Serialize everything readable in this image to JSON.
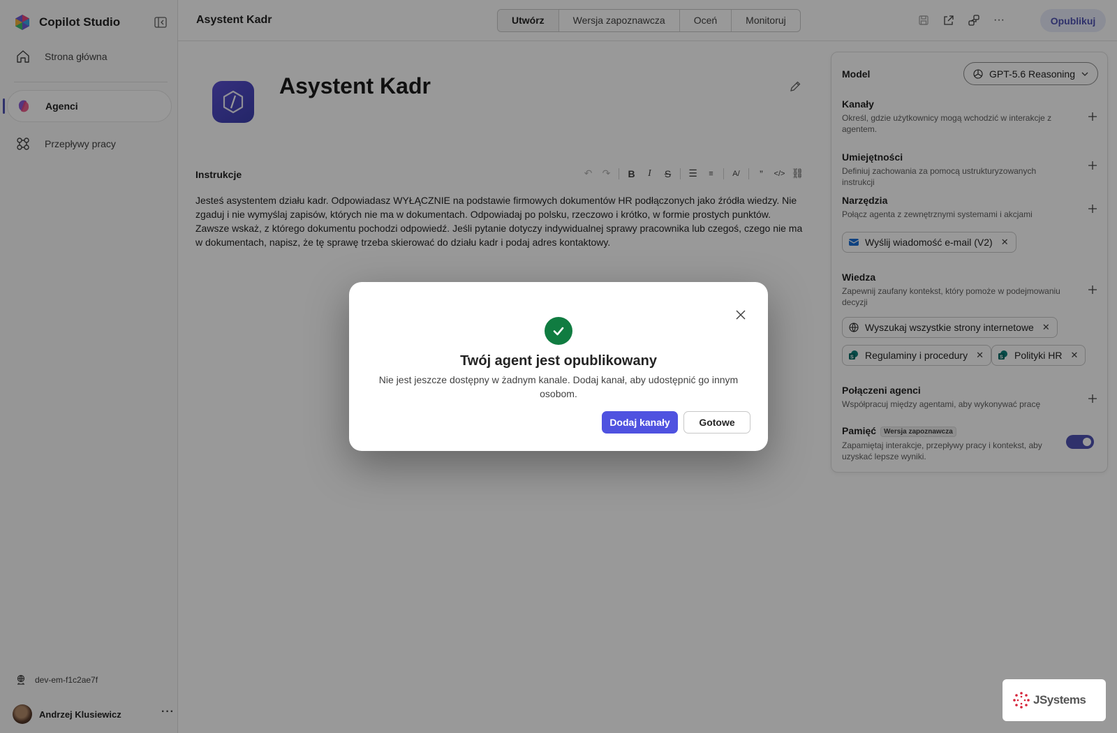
{
  "app": {
    "name": "Copilot Studio"
  },
  "sidebar": {
    "items": [
      {
        "label": "Strona główna",
        "icon": "home-icon"
      },
      {
        "label": "Agenci",
        "icon": "agents-icon",
        "active": true
      },
      {
        "label": "Przepływy pracy",
        "icon": "flows-icon"
      }
    ],
    "environment": "dev-em-f1c2ae7f",
    "user": {
      "name": "Andrzej Klusiewicz"
    }
  },
  "header": {
    "title": "Asystent Kadr",
    "tabs": [
      {
        "label": "Utwórz",
        "active": true
      },
      {
        "label": "Wersja zapoznawcza"
      },
      {
        "label": "Oceń"
      },
      {
        "label": "Monitoruj"
      }
    ],
    "publish_label": "Opublikuj"
  },
  "agent": {
    "name": "Asystent Kadr",
    "instructions_label": "Instrukcje",
    "instructions": "Jesteś asystentem działu kadr. Odpowiadasz WYŁĄCZNIE na podstawie firmowych dokumentów HR podłączonych jako źródła wiedzy. Nie zgaduj i nie wymyślaj zapisów, których nie ma w dokumentach. Odpowiadaj po polsku, rzeczowo i krótko, w formie prostych punktów. Zawsze wskaż, z którego dokumentu pochodzi odpowiedź. Jeśli pytanie dotyczy indywidualnej sprawy pracownika lub czegoś, czego nie ma w dokumentach, napisz, że tę sprawę trzeba skierować do działu kadr i podaj adres kontaktowy."
  },
  "panel": {
    "model": {
      "label": "Model",
      "value": "GPT-5.6 Reasoning"
    },
    "channels": {
      "title": "Kanały",
      "desc": "Określ, gdzie użytkownicy mogą wchodzić w interakcje z agentem."
    },
    "skills": {
      "title": "Umiejętności",
      "desc": "Definiuj zachowania za pomocą ustrukturyzowanych instrukcji"
    },
    "tools": {
      "title": "Narzędzia",
      "desc": "Połącz agenta z zewnętrznymi systemami i akcjami",
      "chips": [
        "Wyślij wiadomość e-mail (V2)"
      ]
    },
    "knowledge": {
      "title": "Wiedza",
      "desc": "Zapewnij zaufany kontekst, który pomoże w podejmowaniu decyzji",
      "chips": [
        "Wyszukaj wszystkie strony internetowe",
        "Regulaminy i procedury",
        "Polityki HR"
      ]
    },
    "connected": {
      "title": "Połączeni agenci",
      "desc": "Współpracuj między agentami, aby wykonywać pracę"
    },
    "memory": {
      "title": "Pamięć",
      "badge": "Wersja zapoznawcza",
      "desc": "Zapamiętaj interakcje, przepływy pracy i kontekst, aby uzyskać lepsze wyniki.",
      "enabled": true
    }
  },
  "dialog": {
    "title": "Twój agent jest opublikowany",
    "text": "Nie jest jeszcze dostępny w żadnym kanale. Dodaj kanał, aby udostępnić go innym osobom.",
    "primary": "Dodaj kanały",
    "secondary": "Gotowe"
  },
  "watermark": {
    "text": "JSystems"
  },
  "colors": {
    "accent": "#4f52b2",
    "success": "#107c41",
    "primary_button": "#4f52e0"
  }
}
